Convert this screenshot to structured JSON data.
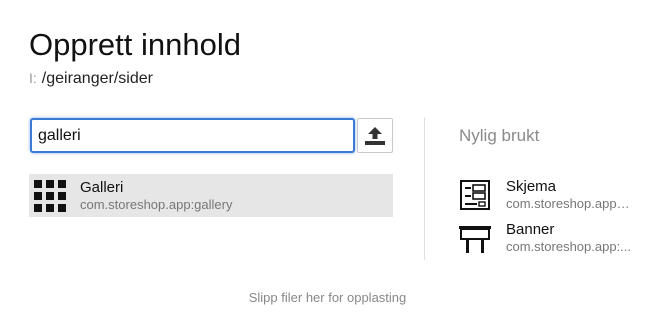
{
  "header": {
    "title": "Opprett innhold",
    "path_prefix": "I:",
    "path": "/geiranger/sider"
  },
  "search": {
    "value": "galleri",
    "placeholder": ""
  },
  "upload": {
    "icon": "upload-icon"
  },
  "results": [
    {
      "name": "Galleri",
      "subtitle": "com.storeshop.app:gallery",
      "icon": "grid-icon"
    }
  ],
  "recent": {
    "title": "Nylig brukt",
    "items": [
      {
        "name": "Skjema",
        "subtitle": "com.storeshop.app:f...",
        "icon": "form-icon"
      },
      {
        "name": "Banner",
        "subtitle": "com.storeshop.app:...",
        "icon": "billboard-icon"
      }
    ]
  },
  "footer": {
    "drop_hint": "Slipp filer her for opplasting"
  },
  "colors": {
    "accent": "#3b7bd6",
    "selected_bg": "#e6e6e6"
  }
}
